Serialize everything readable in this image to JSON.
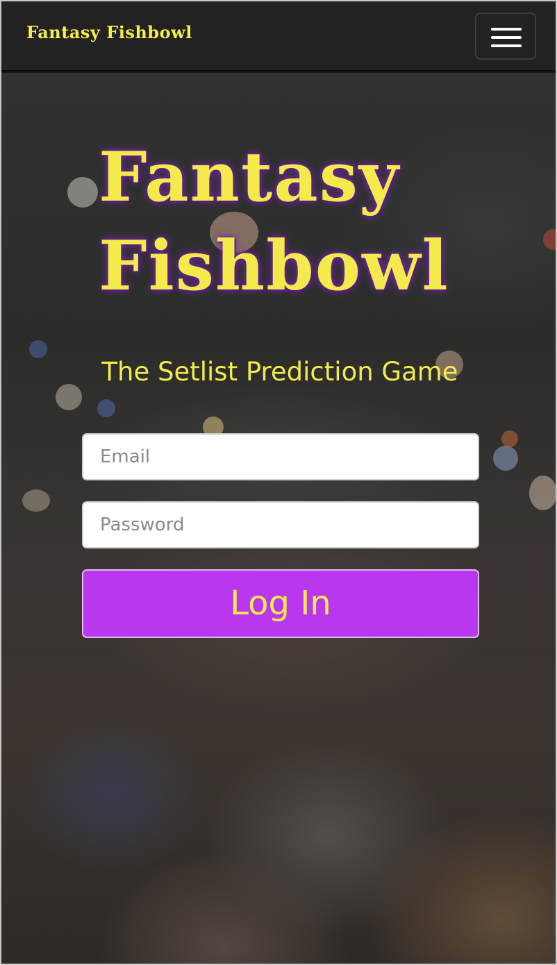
{
  "navbar": {
    "brand": "Fantasy Fishbowl",
    "menu_icon": "hamburger-menu-icon"
  },
  "hero": {
    "title_line1": "Fantasy",
    "title_line2": "Fishbowl",
    "tagline": "The Setlist Prediction Game"
  },
  "login_form": {
    "email_placeholder": "Email",
    "email_value": "",
    "password_placeholder": "Password",
    "password_value": "",
    "submit_label": "Log In"
  },
  "colors": {
    "brand_yellow": "#f4ea4c",
    "button_purple": "#b937ee",
    "navbar_bg": "#222222",
    "glow_purple": "#7c2bb8"
  }
}
